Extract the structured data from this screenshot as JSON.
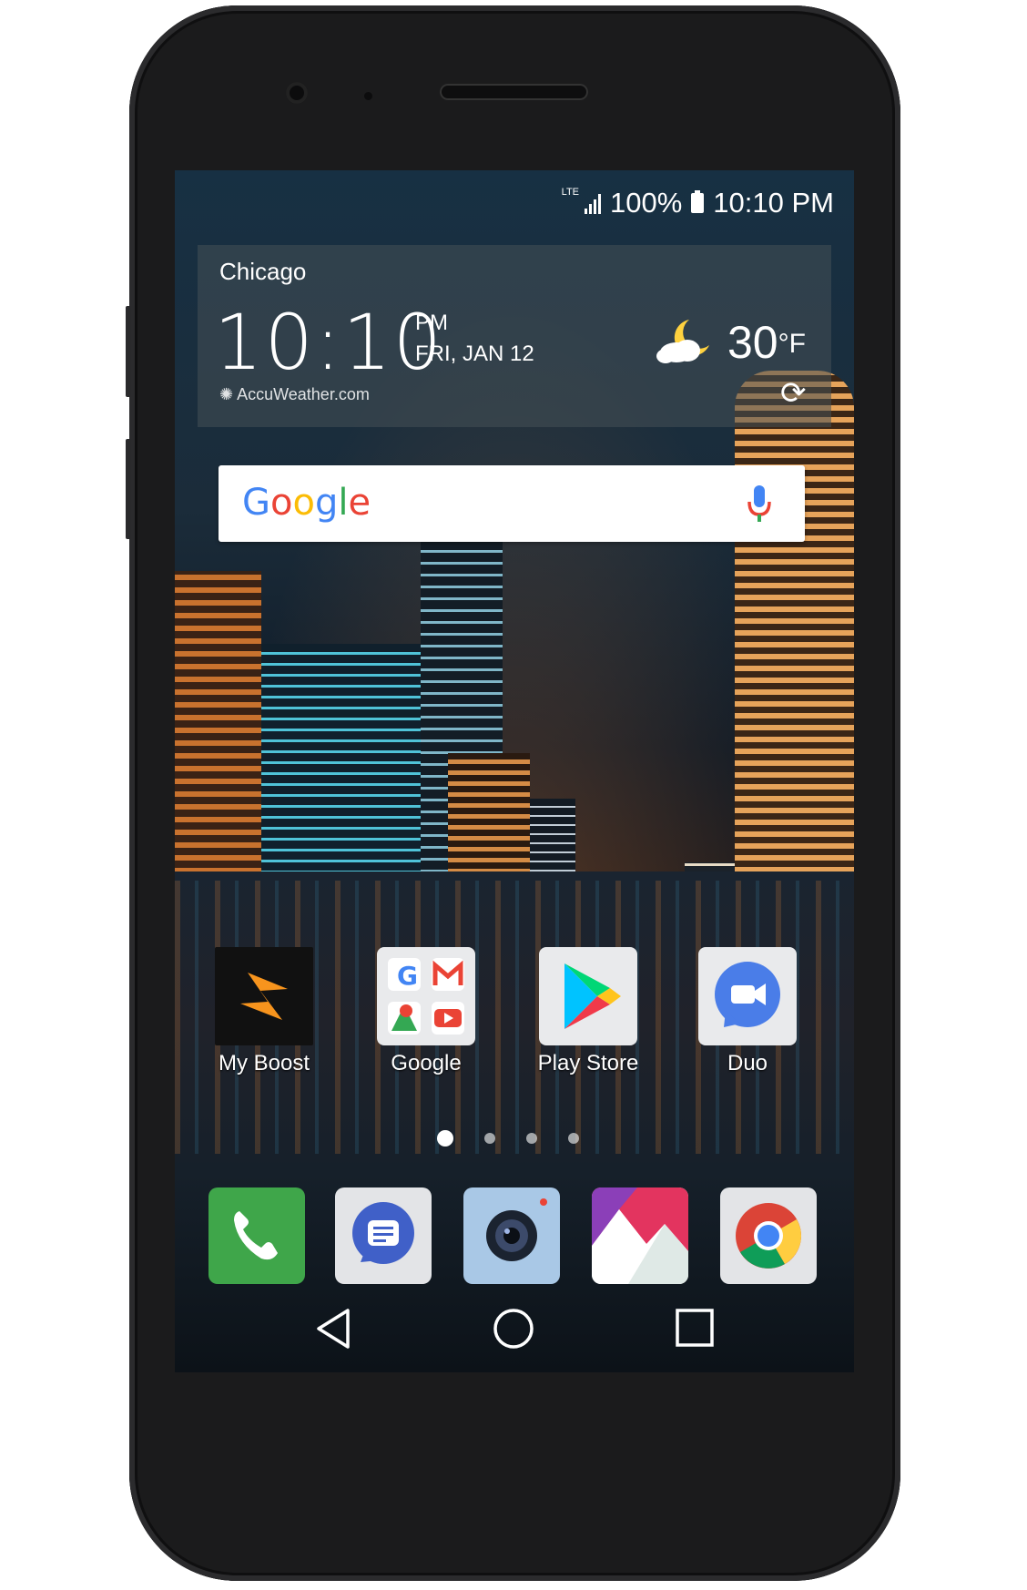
{
  "status_bar": {
    "network": "LTE",
    "battery": "100%",
    "time": "10:10 PM"
  },
  "weather": {
    "city": "Chicago",
    "time": "10:10",
    "ampm": "PM",
    "date": "FRI, JAN 12",
    "temp": "30",
    "unit": "°F",
    "provider": "AccuWeather.com",
    "condition_icon": "partly-cloudy-night-icon"
  },
  "search": {
    "logo": "Google",
    "mic_icon": "mic-icon"
  },
  "apps": [
    {
      "label": "My Boost",
      "icon": "boost-icon"
    },
    {
      "label": "Google",
      "icon": "google-folder-icon"
    },
    {
      "label": "Play Store",
      "icon": "play-store-icon"
    },
    {
      "label": "Duo",
      "icon": "duo-icon"
    }
  ],
  "pages": {
    "count": 4,
    "active": 1
  },
  "dock": [
    {
      "icon": "phone-icon"
    },
    {
      "icon": "messages-icon"
    },
    {
      "icon": "camera-icon"
    },
    {
      "icon": "gallery-icon"
    },
    {
      "icon": "chrome-icon"
    }
  ],
  "navbar": {
    "back": "back-icon",
    "home": "home-icon",
    "recents": "recents-icon"
  },
  "colors": {
    "boost_orange": "#f7941d",
    "phone_green": "#3fa64a",
    "google_blue": "#4285f4",
    "google_red": "#ea4335",
    "google_yellow": "#fbbc05",
    "google_green": "#34a853"
  }
}
